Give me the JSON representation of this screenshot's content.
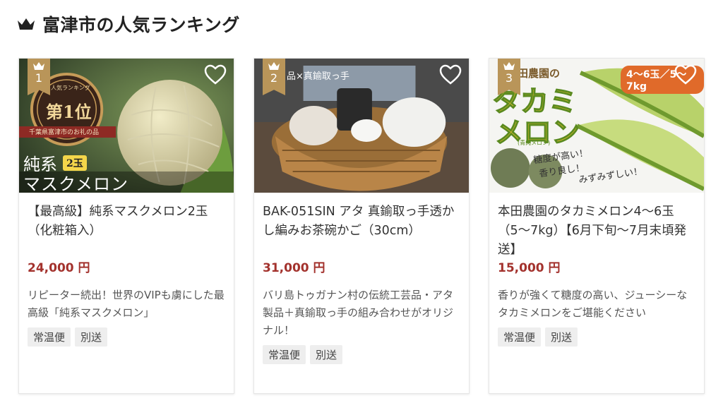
{
  "header": {
    "title": "富津市の人気ランキング",
    "icon": "crown-icon"
  },
  "colors": {
    "price": "#a3322d",
    "badge": "#b99559",
    "tag_bg": "#eeeeee"
  },
  "cards": [
    {
      "rank": "1",
      "name": "【最高級】純系マスクメロン2玉（化粧箱入）",
      "price": "24,000 円",
      "description": "リピーター続出！世界のVIPも虜にした最高級「純系マスクメロン」",
      "tags": [
        "常温便",
        "別送"
      ],
      "image_text": {
        "award_top": "人気ランキング",
        "award_main": "第1位",
        "award_ribbon": "千葉県富津市のお礼の品",
        "line1": "純系",
        "badge": "2玉",
        "line2": "マスクメロン"
      }
    },
    {
      "rank": "2",
      "name": "BAK-051SIN アタ 真鍮取っ手透かし編みお茶碗かご（30cm）",
      "price": "31,000 円",
      "description": "バリ島トゥガナン村の伝統工芸品・アタ製品＋真鍮取っ手の組み合わせがオリジナル！",
      "tags": [
        "常温便",
        "別送"
      ],
      "image_text": {
        "caption": "品×真鍮取っ手"
      }
    },
    {
      "rank": "3",
      "name": "本田農園のタカミメロン4〜6玉（5〜7kg）【6月下旬〜7月末頃発送】",
      "price": "15,000 円",
      "description": "香りが強くて糖度の高い、ジューシーなタカミメロンをご堪能ください",
      "tags": [
        "常温便",
        "別送"
      ],
      "image_text": {
        "farm": "田農園の",
        "brand1": "タカミ",
        "brand2": "メロン",
        "sub": "(青肉メロン)",
        "count": "4〜6玉／5〜7kg",
        "copy1": "糖度が高い！",
        "copy2": "香り良し！",
        "copy3": "みずみずしい！"
      }
    }
  ]
}
